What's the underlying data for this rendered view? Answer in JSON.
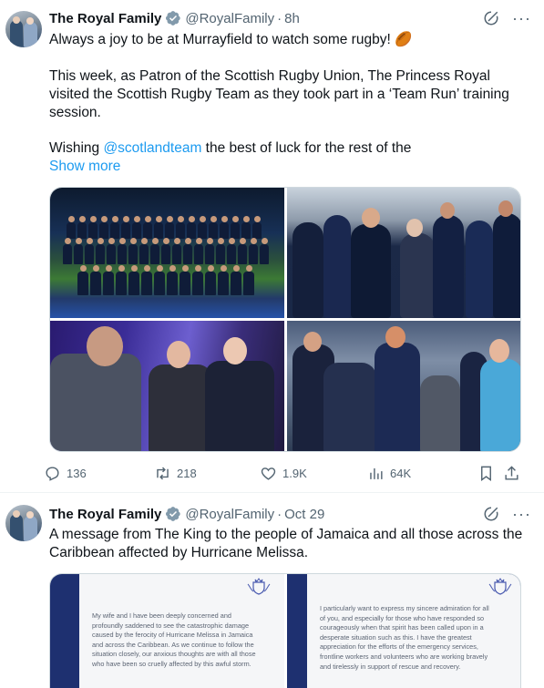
{
  "tweets": [
    {
      "name": "The Royal Family",
      "handle": "@RoyalFamily",
      "separator": "·",
      "time": "8h",
      "text_line1": "Always a joy to be at Murrayfield to watch some rugby! 🏉",
      "text_para2": "This week, as Patron of the Scottish Rugby Union, The Princess Royal visited the Scottish Rugby Team as they took part in a ‘Team Run’ training session.",
      "text_para3_prefix": "Wishing ",
      "mention": "@scotlandteam",
      "text_para3_suffix": " the best of luck for the rest of the",
      "show_more": "Show more",
      "stats": {
        "replies": "136",
        "reposts": "218",
        "likes": "1.9K",
        "views": "64K"
      }
    },
    {
      "name": "The Royal Family",
      "handle": "@RoyalFamily",
      "separator": "·",
      "time": "Oct 29",
      "text": "A message from The King to the people of Jamaica and all those across the Caribbean affected by Hurricane Melissa.",
      "letter_left": "My wife and I have been deeply concerned and profoundly saddened to see the catastrophic damage caused by the ferocity of Hurricane Melissa in Jamaica and across the Caribbean. As we continue to follow the situation closely, our anxious thoughts are with all those who have been so cruelly affected by this awful storm.",
      "letter_right": "I particularly want to express my sincere admiration for all of you, and especially for those who have responded so courageously when that spirit has been called upon in a desperate situation such as this. I have the greatest appreciation for the efforts of the emergency services, frontline workers and volunteers who are working bravely and tirelessly in support of rescue and recovery."
    }
  ],
  "colors": {
    "link": "#1d9bf0",
    "secondary_text": "#536471",
    "verified_badge": "#829aab"
  },
  "icons": [
    "verified-badge-icon",
    "grok-icon",
    "more-icon",
    "reply-icon",
    "repost-icon",
    "like-icon",
    "views-icon",
    "bookmark-icon",
    "share-icon",
    "royal-crest-icon"
  ]
}
